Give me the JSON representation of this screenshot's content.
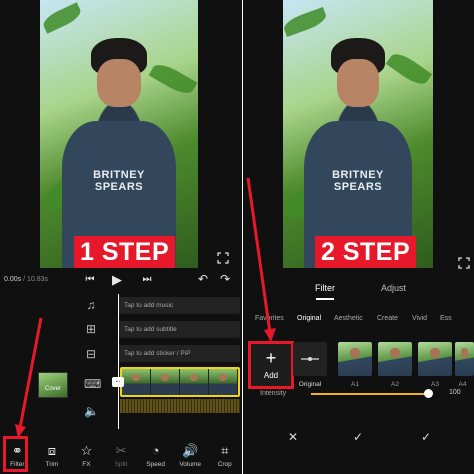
{
  "left": {
    "step_label": "1 STEP",
    "shirt_print": "BRITNEY SPEARS",
    "timecode": {
      "current": "0.00s",
      "total": " / 10.83s"
    },
    "tracks": {
      "music": "Tap to add music",
      "subtitle": "Tap to add subtitle",
      "sticker": "Tap to add sticker / PiP"
    },
    "cover_label": "Cover",
    "toolbar": [
      {
        "label": "Filter",
        "icon": "filter-icon"
      },
      {
        "label": "Trim",
        "icon": "trim-icon"
      },
      {
        "label": "FX",
        "icon": "fx-icon"
      },
      {
        "label": "Split",
        "icon": "split-icon"
      },
      {
        "label": "Speed",
        "icon": "speed-icon"
      },
      {
        "label": "Volume",
        "icon": "volume-icon"
      },
      {
        "label": "Crop",
        "icon": "crop-icon"
      }
    ]
  },
  "right": {
    "step_label": "2 STEP",
    "shirt_print": "BRITNEY SPEARS",
    "tabs": [
      "Filter",
      "Adjust"
    ],
    "categories": [
      "Favorites",
      "Original",
      "Aesthetic",
      "Create",
      "Vivid",
      "Ess"
    ],
    "add_label": "Add",
    "add_plus": "+",
    "filters": [
      "Original",
      "A1",
      "A2",
      "A3",
      "A4"
    ],
    "intensity_label": "Intensity",
    "intensity_value": "100",
    "intensity_level": 0.95
  },
  "colors": {
    "highlight": "#e8182b",
    "clip_border": "#f2d21b",
    "slider": "#f2b61b"
  }
}
